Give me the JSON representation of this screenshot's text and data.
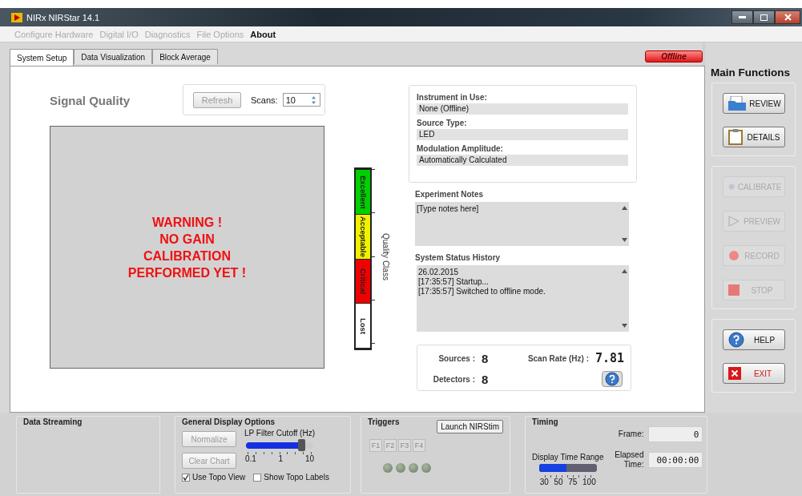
{
  "window": {
    "title": "NIRx NIRStar 14.1"
  },
  "menu": [
    {
      "label": "Configure Hardware",
      "disabled": true
    },
    {
      "label": "Digital I/O",
      "disabled": true
    },
    {
      "label": "Diagnostics",
      "disabled": true
    },
    {
      "label": "File Options",
      "disabled": true
    },
    {
      "label": "About",
      "disabled": false
    }
  ],
  "tabs": [
    {
      "label": "System Setup",
      "selected": true
    },
    {
      "label": "Data Visualization",
      "selected": false
    },
    {
      "label": "Block Average",
      "selected": false
    }
  ],
  "status_badge": "Offline",
  "signal_quality": {
    "title": "Signal Quality",
    "refresh": "Refresh",
    "scans_label": "Scans:",
    "scans_value": "10",
    "warning": "WARNING !\nNO GAIN\nCALIBRATION\nPERFORMED YET !"
  },
  "quality_scale": {
    "axis_label": "Quality Class",
    "segments": [
      {
        "label": "Excellent",
        "color": "#00d000"
      },
      {
        "label": "Acceptable",
        "color": "#f0f000"
      },
      {
        "label": "Critical",
        "color": "#f00000"
      },
      {
        "label": "Lost",
        "color": "#ffffff"
      }
    ]
  },
  "instrument": [
    {
      "label": "Instrument in Use:",
      "value": "None (Offline)"
    },
    {
      "label": "Source Type:",
      "value": "LED"
    },
    {
      "label": "Modulation Amplitude:",
      "value": "Automatically Calculated"
    }
  ],
  "experiment_notes": {
    "title": "Experiment Notes",
    "value": "[Type notes here]"
  },
  "status_history": {
    "title": "System Status History",
    "lines": [
      "26.02.2015",
      "[17:35:57] Startup...",
      "[17:35:57] Switched to offline mode."
    ]
  },
  "counts": {
    "sources_label": "Sources :",
    "sources": "8",
    "detectors_label": "Detectors :",
    "detectors": "8",
    "scan_rate_label": "Scan Rate (Hz) :",
    "scan_rate": "7.81"
  },
  "main_functions": {
    "title": "Main Functions",
    "groups": [
      [
        {
          "label": "REVIEW",
          "kind": "review",
          "disabled": false
        },
        {
          "label": "DETAILS",
          "kind": "details",
          "disabled": false
        }
      ],
      [
        {
          "label": "CALIBRATE",
          "kind": "calibrate",
          "disabled": true
        },
        {
          "label": "PREVIEW",
          "kind": "preview",
          "disabled": true
        },
        {
          "label": "RECORD",
          "kind": "record",
          "disabled": true
        },
        {
          "label": "STOP",
          "kind": "stop",
          "disabled": true
        }
      ],
      [
        {
          "label": "HELP",
          "kind": "help",
          "disabled": false
        },
        {
          "label": "EXIT",
          "kind": "exit",
          "disabled": false
        }
      ]
    ]
  },
  "data_streaming": {
    "title": "Data Streaming"
  },
  "display_options": {
    "title": "General Display Options",
    "buttons": [
      {
        "label": "Normalize",
        "disabled": true
      },
      {
        "label": "Clear Chart",
        "disabled": true
      }
    ],
    "slider": {
      "label": "LP Filter Cutoff (Hz)",
      "level": 0.83,
      "ticks": [
        "0.1",
        "1",
        "10"
      ]
    },
    "checkboxes": [
      {
        "label": "Use Topo View",
        "checked": true
      },
      {
        "label": "Show Topo Labels",
        "checked": false
      }
    ]
  },
  "triggers": {
    "title": "Triggers",
    "launch": "Launch NIRStim",
    "keys": [
      {
        "label": "F1",
        "disabled": true
      },
      {
        "label": "F2",
        "disabled": true
      },
      {
        "label": "F3",
        "disabled": true
      },
      {
        "label": "F4",
        "disabled": true
      }
    ],
    "leds": [
      {
        "on": false
      },
      {
        "on": false
      },
      {
        "on": false
      },
      {
        "on": false
      }
    ]
  },
  "timing": {
    "title": "Timing",
    "range": {
      "label": "Display Time Range",
      "level": 0.48,
      "ticks": [
        "30",
        "50",
        "75",
        "100"
      ]
    },
    "frame_label": "Frame:",
    "frame": "0",
    "elapsed_label": "Elapsed\nTime:",
    "elapsed": "00:00:00"
  }
}
